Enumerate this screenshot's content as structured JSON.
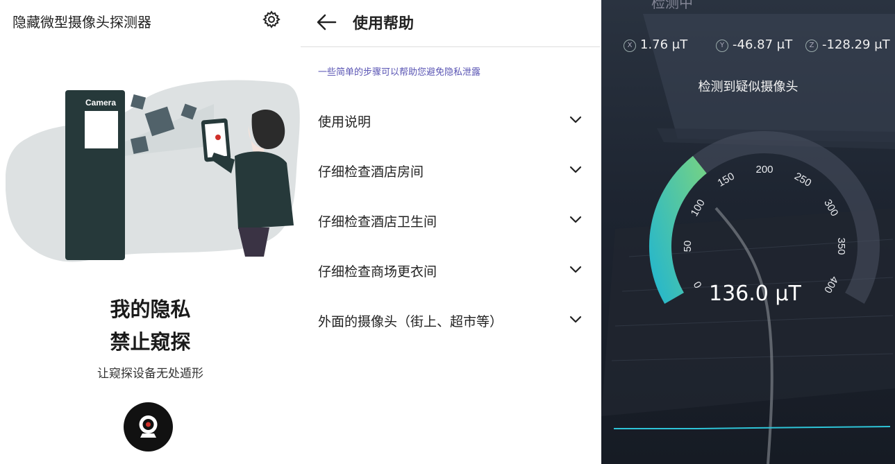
{
  "panel1": {
    "app_title": "隐藏微型摄像头探测器",
    "settings_icon": "gear-icon",
    "illustration_text": "Camera",
    "slogan_line1": "我的隐私",
    "slogan_line2": "禁止窥探",
    "subtitle": "让窥探设备无处遁形",
    "scan_button_icon": "webcam-icon",
    "colors": {
      "dark_teal": "#26393a",
      "accent_red": "#d0302a"
    }
  },
  "panel2": {
    "back_icon": "arrow-left-icon",
    "title": "使用帮助",
    "intro": "一些简单的步骤可以帮助您避免隐私泄露",
    "items": [
      {
        "label": "使用说明"
      },
      {
        "label": "仔细检查酒店房间"
      },
      {
        "label": "仔细检查酒店卫生间"
      },
      {
        "label": "仔细检查商场更衣间"
      },
      {
        "label": "外面的摄像头（街上、超市等）"
      }
    ],
    "colors": {
      "intro": "#5a55b4"
    }
  },
  "panel3": {
    "status": "检测中",
    "x_axis": {
      "label": "X",
      "value": "1.76 μT"
    },
    "y_axis": {
      "label": "Y",
      "value": "-46.87 μT"
    },
    "z_axis": {
      "label": "Z",
      "value": "-128.29 μT"
    },
    "detection_message": "检测到疑似摄像头",
    "gauge": {
      "min": 0,
      "max": 400,
      "value": 136.0,
      "ticks": [
        "0",
        "50",
        "100",
        "150",
        "200",
        "250",
        "300",
        "350",
        "400"
      ]
    },
    "reading": "136.0 μT",
    "colors": {
      "gauge_start": "#2ab8c8",
      "gauge_end": "#6fd08a",
      "wave": "#2ec4d8"
    }
  }
}
